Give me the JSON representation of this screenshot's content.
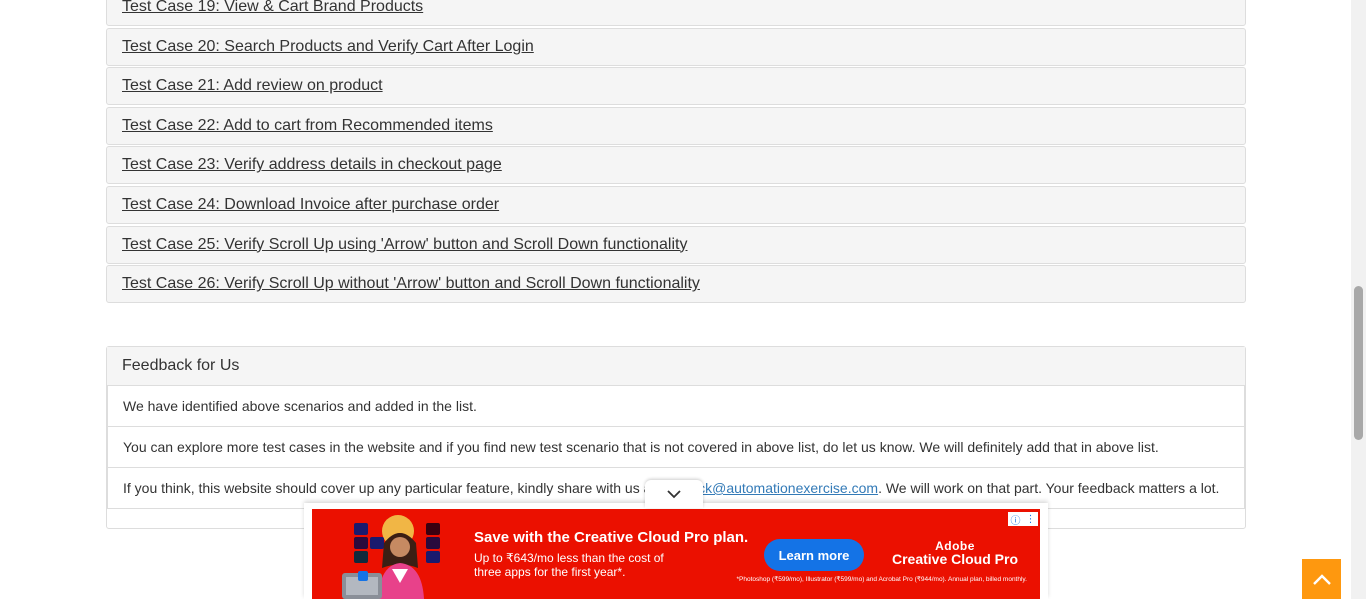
{
  "test_cases": [
    "Test Case 19: View & Cart Brand Products",
    "Test Case 20: Search Products and Verify Cart After Login",
    "Test Case 21: Add review on product",
    "Test Case 22: Add to cart from Recommended items",
    "Test Case 23: Verify address details in checkout page",
    "Test Case 24: Download Invoice after purchase order",
    "Test Case 25: Verify Scroll Up using 'Arrow' button and Scroll Down functionality",
    "Test Case 26: Verify Scroll Up without 'Arrow' button and Scroll Down functionality"
  ],
  "feedback": {
    "title": "Feedback for Us",
    "line1": "We have identified above scenarios and added in the list.",
    "line2": "You can explore more test cases in the website and if you find new test scenario that is not covered in above list, do let us know. We will definitely add that in above list.",
    "line3_prefix": "If you think, this website should cover up any particular feature, kindly share with us at ",
    "line3_email": "feedback@automationexercise.com",
    "line3_suffix": ". We will work on that part. Your feedback matters a lot."
  },
  "ad": {
    "headline": "Save with the Creative Cloud Pro plan.",
    "subtext": "Up to ₹643/mo less than the cost of three apps for the first year*.",
    "button": "Learn more",
    "brand_line1": "Adobe",
    "brand_line2": "Creative Cloud Pro",
    "fineprint": "*Photoshop (₹599/mo), Illustrator (₹599/mo) and Acrobat Pro (₹944/mo). Annual plan, billed monthly.",
    "background": "#eb1000",
    "button_color": "#1473e6",
    "app_icons": [
      "Ps",
      "Ai",
      "Id",
      "Pr",
      "Ae",
      "Lr"
    ]
  },
  "icons": {
    "scroll_up": "chevron-up-icon",
    "ad_collapse": "chevron-down-icon",
    "ad_info": "info-icon",
    "ad_menu": "more-vertical-icon"
  },
  "colors": {
    "scroll_up_button": "#fe980f",
    "link": "#337ab7"
  }
}
